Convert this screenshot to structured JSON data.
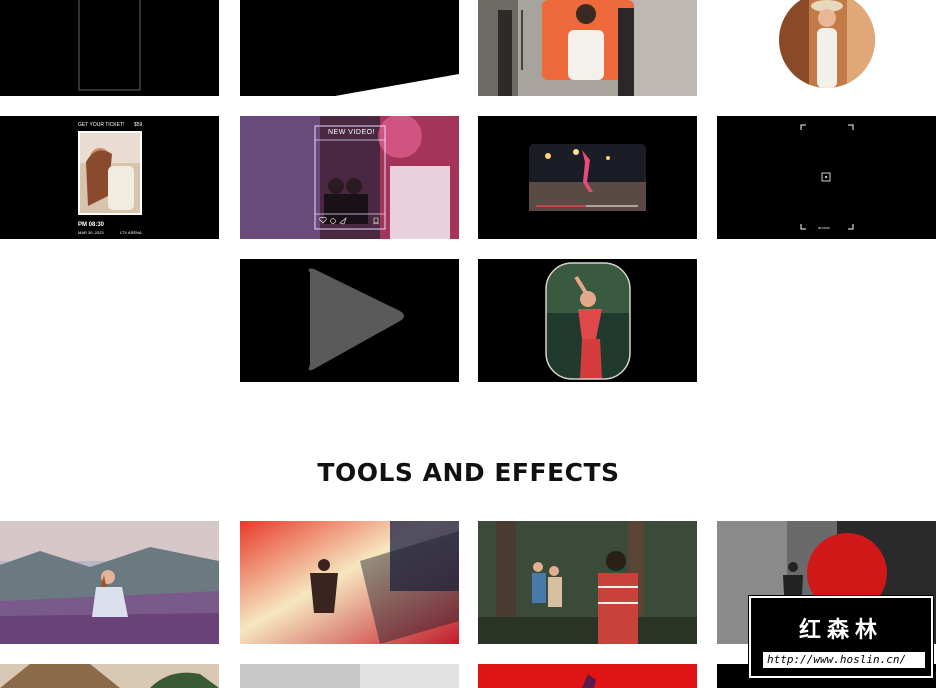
{
  "ticket_card": {
    "header": "GET YOUR TICKET!",
    "price": "$59",
    "time": "PM 08:30",
    "date": "MAR 30, 2023",
    "venue": "LTV ARENA"
  },
  "post_card": {
    "label": "NEW VIDEO!"
  },
  "camera_frame": {
    "readout": "00:00:00"
  },
  "tools_section": {
    "title": "TOOLS AND EFFECTS"
  },
  "watermark": {
    "title": "红森林",
    "url": "http://www.hoslin.cn/"
  },
  "colors": {
    "tile_black": "#000000",
    "post_border": "#e8d8ff",
    "accent_red": "#d01818"
  },
  "icons": [
    "play-icon",
    "heart-icon",
    "comment-icon",
    "share-icon",
    "bookmark-icon",
    "focus-icon"
  ]
}
